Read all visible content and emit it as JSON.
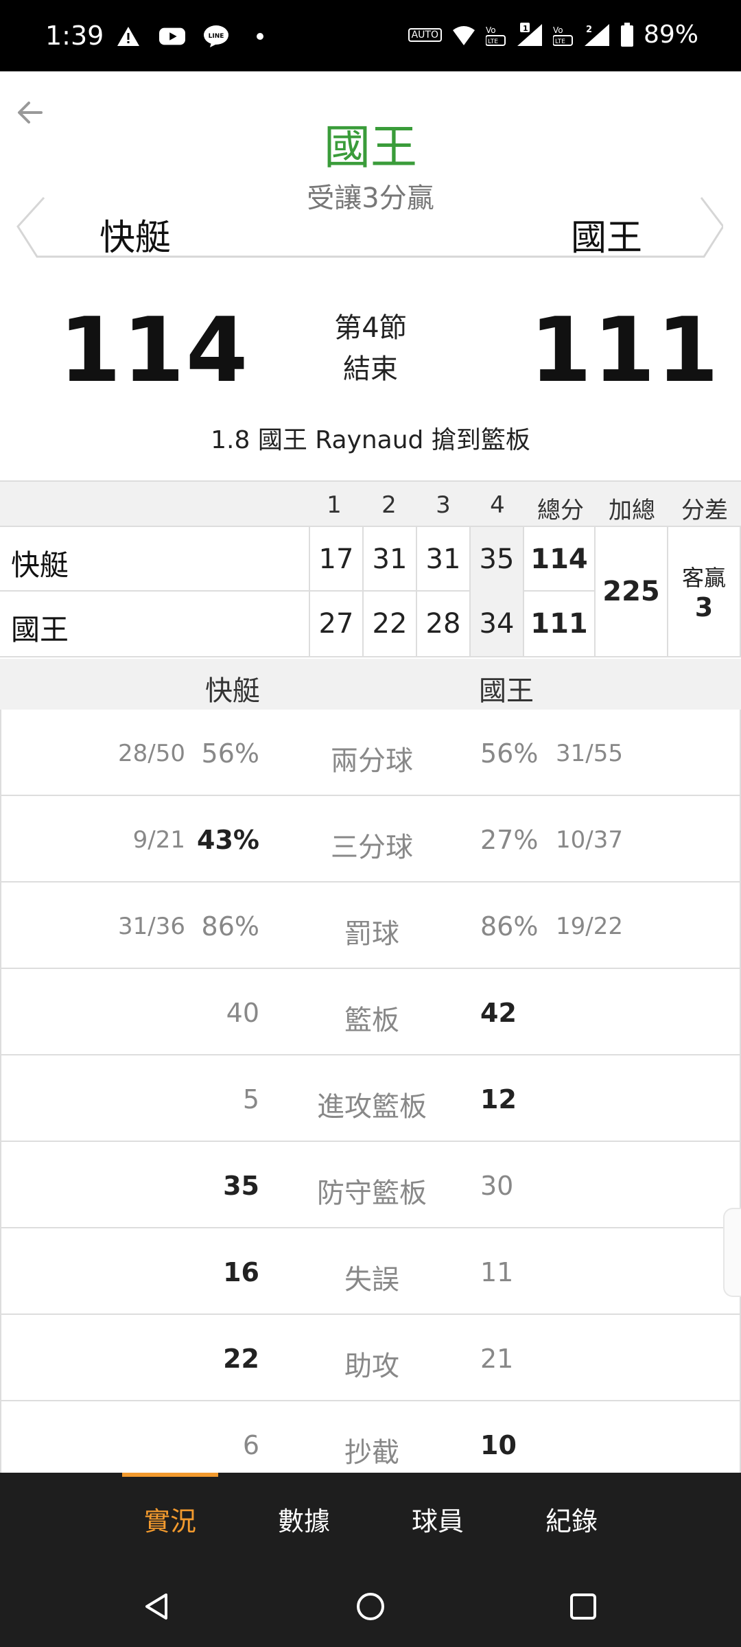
{
  "status_bar": {
    "time": "1:39",
    "icons_left": [
      "warning-icon",
      "youtube-icon",
      "line-icon",
      "dot-icon"
    ],
    "icons_right": [
      "auto-hz-icon",
      "wifi-6-icon",
      "volte-1-icon",
      "signal-1-icon",
      "volte-2-icon",
      "signal-2-icon",
      "battery-icon"
    ],
    "auto_label": "AUTO",
    "battery": "89%"
  },
  "header": {
    "pick_team": "國王",
    "pick_desc": "受讓3分贏",
    "away_team": "快艇",
    "home_team": "國王",
    "away_score": "114",
    "home_score": "111",
    "period": "第4節",
    "status": "結束",
    "last_play": "1.8 國王 Raynaud 搶到籃板"
  },
  "boxscore": {
    "headers": [
      "1",
      "2",
      "3",
      "4",
      "總分",
      "加總",
      "分差"
    ],
    "rows": [
      {
        "team": "快艇",
        "q": [
          "17",
          "31",
          "31",
          "35"
        ],
        "total": "114"
      },
      {
        "team": "國王",
        "q": [
          "27",
          "22",
          "28",
          "34"
        ],
        "total": "111"
      }
    ],
    "sum": "225",
    "diff_label": "客贏",
    "diff": "3"
  },
  "stats": {
    "away_team": "快艇",
    "home_team": "國王",
    "rows": [
      {
        "label": "兩分球",
        "away_frac": "28/50",
        "away": "56%",
        "home": "56%",
        "home_frac": "31/55",
        "bold": "none"
      },
      {
        "label": "三分球",
        "away_frac": "9/21",
        "away": "43%",
        "home": "27%",
        "home_frac": "10/37",
        "bold": "away"
      },
      {
        "label": "罰球",
        "away_frac": "31/36",
        "away": "86%",
        "home": "86%",
        "home_frac": "19/22",
        "bold": "none"
      },
      {
        "label": "籃板",
        "away_frac": "",
        "away": "40",
        "home": "42",
        "home_frac": "",
        "bold": "home"
      },
      {
        "label": "進攻籃板",
        "away_frac": "",
        "away": "5",
        "home": "12",
        "home_frac": "",
        "bold": "home"
      },
      {
        "label": "防守籃板",
        "away_frac": "",
        "away": "35",
        "home": "30",
        "home_frac": "",
        "bold": "away"
      },
      {
        "label": "失誤",
        "away_frac": "",
        "away": "16",
        "home": "11",
        "home_frac": "",
        "bold": "away"
      },
      {
        "label": "助攻",
        "away_frac": "",
        "away": "22",
        "home": "21",
        "home_frac": "",
        "bold": "away"
      },
      {
        "label": "抄截",
        "away_frac": "",
        "away": "6",
        "home": "10",
        "home_frac": "",
        "bold": "home"
      }
    ]
  },
  "tabs": {
    "items": [
      "實況",
      "數據",
      "球員",
      "紀錄"
    ],
    "active": "實況"
  },
  "colors": {
    "pick": "#3a9c3a",
    "accent": "#f29a2e",
    "tabbar": "#1e1e1e"
  }
}
